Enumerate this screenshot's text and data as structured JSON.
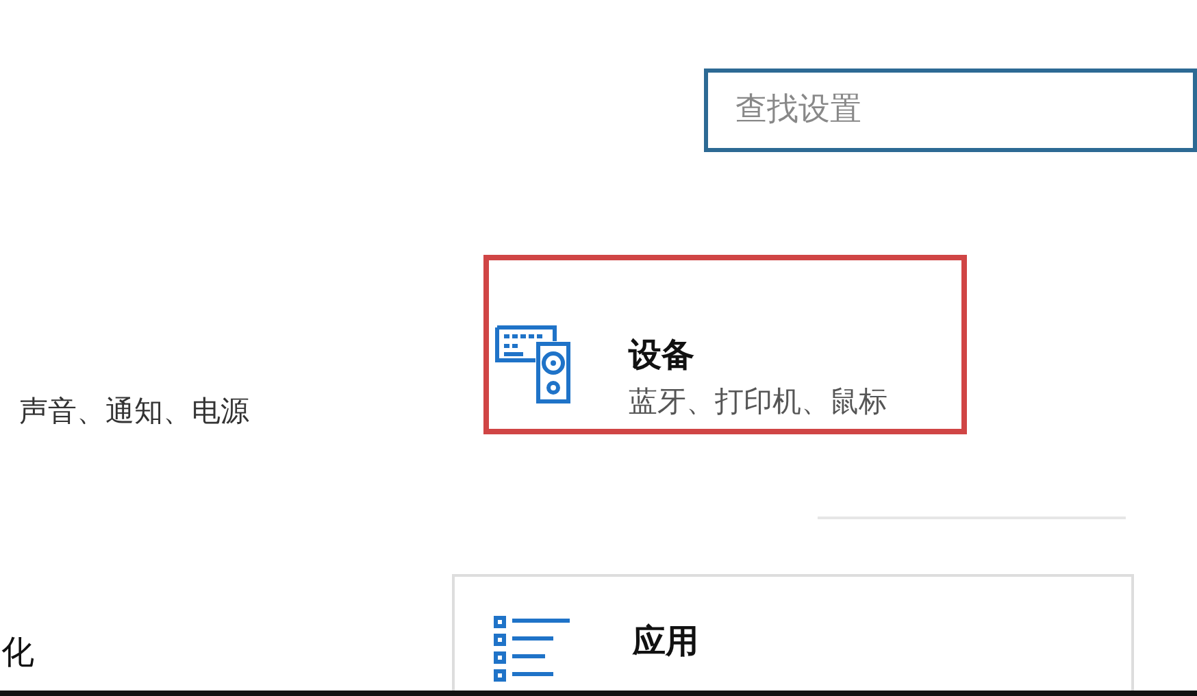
{
  "search": {
    "placeholder": "查找设置"
  },
  "left_column": [
    {
      "title": "声音、通知、电源",
      "kind": "subtitle"
    },
    {
      "title": "化",
      "kind": "title"
    }
  ],
  "tiles": [
    {
      "kind": "devices",
      "title": "设备",
      "subtitle": "蓝牙、打印机、鼠标",
      "highlighted": true
    },
    {
      "kind": "apps",
      "title": "应用",
      "highlighted": false
    }
  ]
}
